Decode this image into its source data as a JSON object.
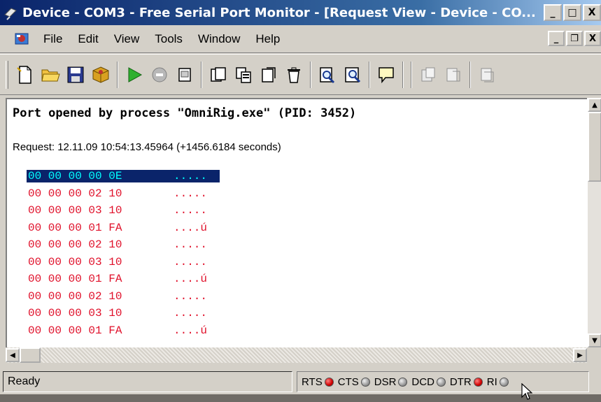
{
  "window": {
    "title": "Device - COM3 - Free Serial Port Monitor - [Request View - Device - CO...",
    "buttons": {
      "minimize": "_",
      "maximize": "□",
      "close": "X"
    }
  },
  "menu": {
    "items": [
      "File",
      "Edit",
      "View",
      "Tools",
      "Window",
      "Help"
    ],
    "mdi_buttons": {
      "minimize": "_",
      "restore": "❐",
      "close": "X"
    }
  },
  "toolbar": {
    "buttons": [
      {
        "icon": "new-document-icon",
        "group": 1
      },
      {
        "icon": "open-folder-icon",
        "group": 1
      },
      {
        "icon": "save-icon",
        "group": 1
      },
      {
        "icon": "package-icon",
        "group": 1
      },
      {
        "icon": "start-play-icon",
        "group": 2
      },
      {
        "icon": "stop-icon",
        "group": 2
      },
      {
        "icon": "clear-icon",
        "group": 2
      },
      {
        "icon": "request-view-icon",
        "group": 3
      },
      {
        "icon": "copy-view-icon",
        "group": 3
      },
      {
        "icon": "dump-view-icon",
        "group": 3
      },
      {
        "icon": "trash-icon",
        "group": 3
      },
      {
        "icon": "find-icon",
        "group": 4
      },
      {
        "icon": "find-next-icon",
        "group": 4
      },
      {
        "icon": "comment-icon",
        "group": 5
      },
      {
        "icon": "send-data-icon",
        "group": 6
      },
      {
        "icon": "modem-signals-icon",
        "group": 6
      },
      {
        "icon": "port-settings-icon",
        "group": 6
      }
    ]
  },
  "content": {
    "port_line": "Port opened by process \"OmniRig.exe\" (PID: 3452)",
    "request_line": "Request: 12.11.09 10:54:13.45964 (+1456.6184 seconds)",
    "rows": [
      {
        "hex": "00 00 00 00 0E",
        "ascii": ".....",
        "selected": true
      },
      {
        "hex": "00 00 00 02 10",
        "ascii": "....."
      },
      {
        "hex": "00 00 00 03 10",
        "ascii": "....."
      },
      {
        "hex": "00 00 00 01 FA",
        "ascii": "....ú"
      },
      {
        "hex": "00 00 00 02 10",
        "ascii": "....."
      },
      {
        "hex": "00 00 00 03 10",
        "ascii": "....."
      },
      {
        "hex": "00 00 00 01 FA",
        "ascii": "....ú"
      },
      {
        "hex": "00 00 00 02 10",
        "ascii": "....."
      },
      {
        "hex": "00 00 00 03 10",
        "ascii": "....."
      },
      {
        "hex": "00 00 00 01 FA",
        "ascii": "....ú"
      }
    ]
  },
  "status": {
    "text": "Ready",
    "signals": [
      {
        "label": "RTS",
        "on": true
      },
      {
        "label": "CTS",
        "on": false
      },
      {
        "label": "DSR",
        "on": false
      },
      {
        "label": "DCD",
        "on": false
      },
      {
        "label": "DTR",
        "on": true
      },
      {
        "label": "RI",
        "on": false
      }
    ]
  },
  "colors": {
    "hex_text": "#e0102a",
    "selection_bg": "#0a246a",
    "selection_text": "#00ffff",
    "titlebar": "#0a246a"
  }
}
